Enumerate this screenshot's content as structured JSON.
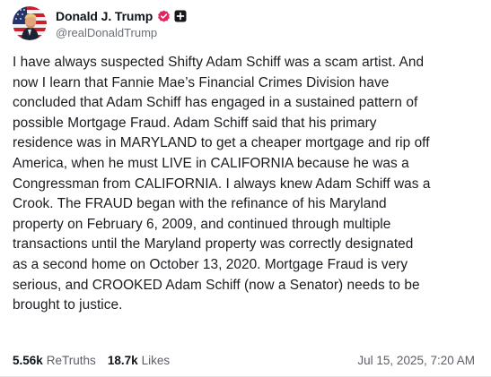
{
  "author": {
    "display_name": "Donald J. Trump",
    "handle": "@realDonaldTrump",
    "avatar_icon": "avatar-portrait-flag",
    "verified_icon": "verified-badge-icon",
    "verified_color": "#e0245e",
    "plus_badge_icon": "plus-square-icon"
  },
  "post": {
    "text": "I have always suspected Shifty Adam Schiff was a scam artist. And\nnow I learn that Fannie Mae’s Financial Crimes Division have\nconcluded that Adam Schiff has engaged in a sustained pattern of\npossible Mortgage Fraud. Adam Schiff said that his primary\nresidence was in MARYLAND to get a cheaper mortgage and rip off\nAmerica, when he must LIVE in CALIFORNIA because he was a\nCongressman from CALIFORNIA. I always knew Adam Schiff was a\nCrook. The FRAUD began with the refinance of his Maryland\nproperty on February 6, 2009, and continued through multiple\ntransactions until the Maryland property was correctly designated\nas a second home on October 13, 2020. Mortgage Fraud is very\nserious, and CROOKED Adam Schiff (now a Senator) needs to be\nbrought to justice."
  },
  "stats": {
    "retruths_count": "5.56k",
    "retruths_label": "ReTruths",
    "likes_count": "18.7k",
    "likes_label": "Likes"
  },
  "timestamp": "Jul 15, 2025, 7:20 AM"
}
